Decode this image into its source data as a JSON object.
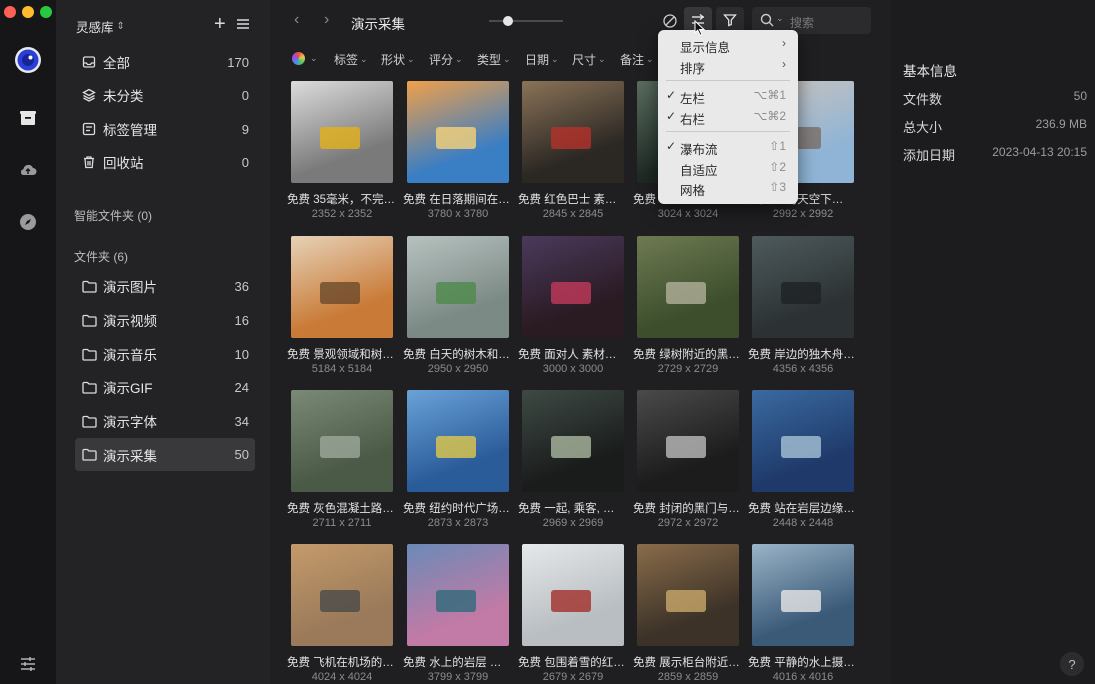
{
  "sidebar": {
    "library_name": "灵感库",
    "library_chevron": "⌃",
    "main_items": [
      {
        "label": "全部",
        "count": "170"
      },
      {
        "label": "未分类",
        "count": "0"
      },
      {
        "label": "标签管理",
        "count": "9"
      },
      {
        "label": "回收站",
        "count": "0"
      }
    ],
    "smart_folders_title": "智能文件夹 (0)",
    "folders_title": "文件夹 (6)",
    "folders": [
      {
        "label": "演示图片",
        "count": "36"
      },
      {
        "label": "演示视频",
        "count": "16"
      },
      {
        "label": "演示音乐",
        "count": "10"
      },
      {
        "label": "演示GIF",
        "count": "24"
      },
      {
        "label": "演示字体",
        "count": "34"
      },
      {
        "label": "演示采集",
        "count": "50"
      }
    ]
  },
  "topbar": {
    "title": "演示采集",
    "search_placeholder": "搜索"
  },
  "filters": [
    "标签",
    "形状",
    "评分",
    "类型",
    "日期",
    "尺寸",
    "备注"
  ],
  "menu": {
    "items": [
      {
        "label": "显示信息",
        "checked": false,
        "shortcut": "",
        "submenu": true
      },
      {
        "label": "排序",
        "checked": false,
        "shortcut": "",
        "submenu": true
      },
      {
        "label": "左栏",
        "checked": true,
        "shortcut": "⌥⌘1",
        "submenu": false
      },
      {
        "label": "右栏",
        "checked": true,
        "shortcut": "⌥⌘2",
        "submenu": false
      },
      {
        "label": "瀑布流",
        "checked": true,
        "shortcut": "⇧1",
        "submenu": false
      },
      {
        "label": "自适应",
        "checked": false,
        "shortcut": "⇧2",
        "submenu": false
      },
      {
        "label": "网格",
        "checked": false,
        "shortcut": "⇧3",
        "submenu": false
      }
    ]
  },
  "grid": [
    {
      "caption": "免费 35毫米，不完…",
      "dims": "2352 x 2352",
      "c1": "#7a7a7a",
      "c2": "#dcdcdc",
      "accent": "#e3b21a"
    },
    {
      "caption": "免费 在日落期间在…",
      "dims": "3780 x 3780",
      "c1": "#3a7ec4",
      "c2": "#f0a04a",
      "accent": "#f6d27a"
    },
    {
      "caption": "免费 红色巴士 素…",
      "dims": "2845 x 2845",
      "c1": "#2b2723",
      "c2": "#8a7358",
      "accent": "#b4322a"
    },
    {
      "caption": "免费 …",
      "dims": "3024 x 3024",
      "c1": "#1e2a24",
      "c2": "#5a6d5f",
      "accent": "#2d3e36"
    },
    {
      "caption": "免费 …的天空下…",
      "dims": "2992 x 2992",
      "c1": "#8fb4d6",
      "c2": "#c9c3bd",
      "accent": "#7a6e66"
    },
    {
      "caption": "免费 景观领域和树…",
      "dims": "5184 x 5184",
      "c1": "#c97a36",
      "c2": "#e6d2b8",
      "accent": "#6b4a2a"
    },
    {
      "caption": "免费 白天的树木和…",
      "dims": "2950 x 2950",
      "c1": "#7c8a86",
      "c2": "#b7c2bf",
      "accent": "#4e8a4a"
    },
    {
      "caption": "免费 面对人 素材…",
      "dims": "3000 x 3000",
      "c1": "#2a1a22",
      "c2": "#4a3a5c",
      "accent": "#c23a5a"
    },
    {
      "caption": "免费 绿树附近的黑…",
      "dims": "2729 x 2729",
      "c1": "#3c4e2c",
      "c2": "#6e7a52",
      "accent": "#b0b09a"
    },
    {
      "caption": "免费 岸边的独木舟…",
      "dims": "4356 x 4356",
      "c1": "#2c3234",
      "c2": "#4e5a5c",
      "accent": "#1e2224"
    },
    {
      "caption": "免费 灰色混凝土路…",
      "dims": "2711 x 2711",
      "c1": "#4a5a46",
      "c2": "#7a8a76",
      "accent": "#9ca89a"
    },
    {
      "caption": "免费 纽约时代广场…",
      "dims": "2873 x 2873",
      "c1": "#2a5c9a",
      "c2": "#6aa2d8",
      "accent": "#e0c84a"
    },
    {
      "caption": "免费 一起, 乘客, …",
      "dims": "2969 x 2969",
      "c1": "#1a1c1c",
      "c2": "#3e4a44",
      "accent": "#aab89e"
    },
    {
      "caption": "免费 封闭的黑门与…",
      "dims": "2972 x 2972",
      "c1": "#1c1c1c",
      "c2": "#4a4a4a",
      "accent": "#bcbcbc"
    },
    {
      "caption": "免费 站在岩层边缘…",
      "dims": "2448 x 2448",
      "c1": "#1f3a6a",
      "c2": "#3a6aa0",
      "accent": "#a6c2d6"
    },
    {
      "caption": "免费 飞机在机场的…",
      "dims": "4024 x 4024",
      "c1": "#9a7a5a",
      "c2": "#c49a6a",
      "accent": "#4a4a4a"
    },
    {
      "caption": "免费 水上的岩层 …",
      "dims": "3799 x 3799",
      "c1": "#c27aa6",
      "c2": "#6a8ab8",
      "accent": "#2f6a7a"
    },
    {
      "caption": "免费 包围着雪的红…",
      "dims": "2679 x 2679",
      "c1": "#b8bec2",
      "c2": "#e6e8ea",
      "accent": "#a32e2a"
    },
    {
      "caption": "免费 展示柜台附近…",
      "dims": "2859 x 2859",
      "c1": "#3c3228",
      "c2": "#8a6c4a",
      "accent": "#c8a86a"
    },
    {
      "caption": "免费 平静的水上摄…",
      "dims": "4016 x 4016",
      "c1": "#3a5a78",
      "c2": "#9ab4c8",
      "accent": "#e6e6e6"
    }
  ],
  "right_panel": {
    "title": "基本信息",
    "rows": [
      {
        "label": "文件数",
        "value": "50"
      },
      {
        "label": "总大小",
        "value": "236.9 MB"
      },
      {
        "label": "添加日期",
        "value": "2023-04-13 20:15"
      }
    ]
  },
  "colors": {
    "accent": "#3b82f6",
    "traffic_red": "#fe5f57",
    "traffic_yellow": "#febc2e",
    "traffic_green": "#28c840"
  }
}
